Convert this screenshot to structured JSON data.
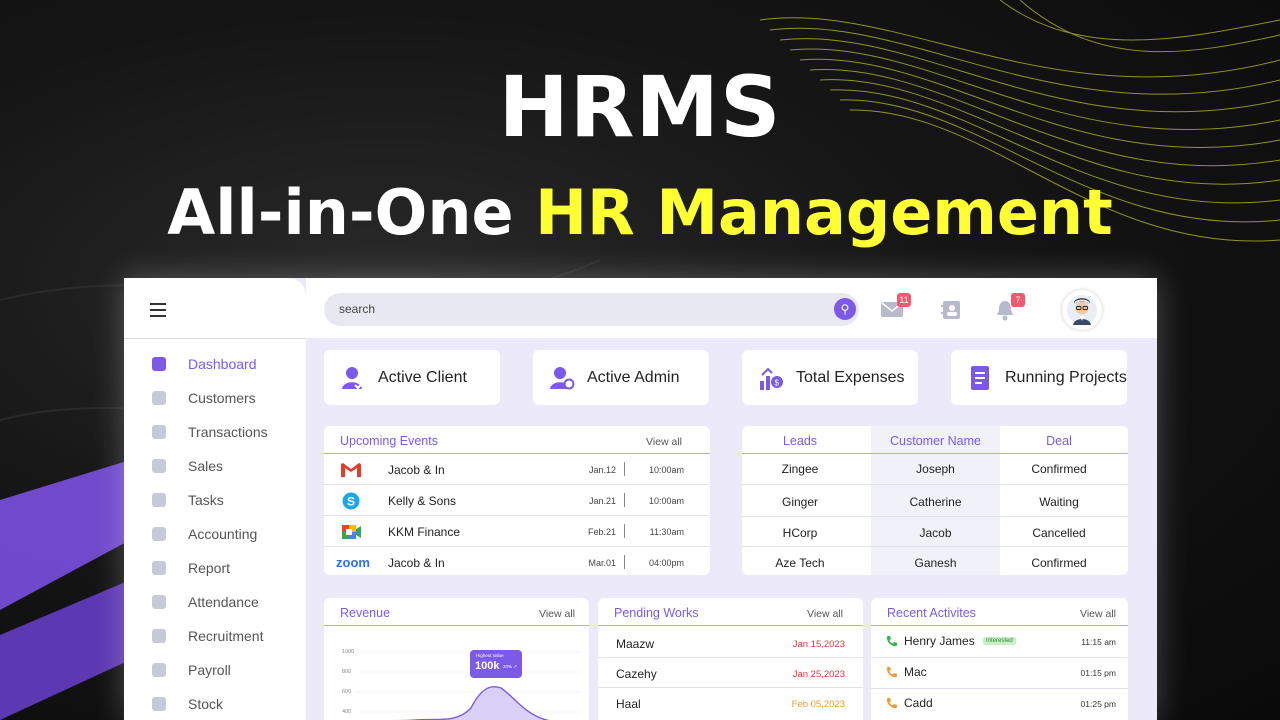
{
  "hero": {
    "title": "HRMS",
    "subtitle_prefix": "All-in-One",
    "subtitle_highlight": "HR Management"
  },
  "topbar": {
    "search_placeholder": "search",
    "mail_badge": "11",
    "notification_badge": "7"
  },
  "sidebar": {
    "items": [
      {
        "label": "Dashboard",
        "icon": "grid-icon",
        "active": true
      },
      {
        "label": "Customers",
        "icon": "star-icon"
      },
      {
        "label": "Transactions",
        "icon": "layers-icon"
      },
      {
        "label": "Sales",
        "icon": "chart-line-icon"
      },
      {
        "label": "Tasks",
        "icon": "task-icon"
      },
      {
        "label": "Accounting",
        "icon": "accounting-icon"
      },
      {
        "label": "Report",
        "icon": "report-icon"
      },
      {
        "label": "Attendance",
        "icon": "attendance-icon"
      },
      {
        "label": "Recruitment",
        "icon": "recruitment-icon"
      },
      {
        "label": "Payroll",
        "icon": "payroll-icon"
      },
      {
        "label": "Stock",
        "icon": "stock-icon"
      }
    ]
  },
  "stats": [
    {
      "label": "Active Client",
      "icon": "client-icon"
    },
    {
      "label": "Active Admin",
      "icon": "admin-icon"
    },
    {
      "label": "Total Expenses",
      "icon": "expenses-icon"
    },
    {
      "label": "Running Projects",
      "icon": "projects-icon"
    }
  ],
  "upcoming_events": {
    "title": "Upcoming Events",
    "view_all": "View all",
    "rows": [
      {
        "logo": "gmail-icon",
        "name": "Jacob & In",
        "date": "Jan.12",
        "time": "10:00am"
      },
      {
        "logo": "skype-icon",
        "name": "Kelly & Sons",
        "date": "Jan.21",
        "time": "10:00am"
      },
      {
        "logo": "meet-icon",
        "name": "KKM Finance",
        "date": "Feb.21",
        "time": "11:30am"
      },
      {
        "logo": "zoom-icon",
        "logo_text": "zoom",
        "name": "Jacob & In",
        "date": "Mar.01",
        "time": "04:00pm"
      }
    ]
  },
  "leads_table": {
    "headers": [
      "Leads",
      "Customer Name",
      "Deal"
    ],
    "rows": [
      [
        "Zingee",
        "Joseph",
        "Confirmed"
      ],
      [
        "Ginger",
        "Catherine",
        "Waiting"
      ],
      [
        "HCorp",
        "Jacob",
        "Cancelled"
      ],
      [
        "Aze Tech",
        "Ganesh",
        "Confirmed"
      ]
    ]
  },
  "revenue": {
    "title": "Revenue",
    "view_all": "View all",
    "y_ticks": [
      "1000",
      "800",
      "600",
      "400"
    ],
    "tooltip_label": "Highest Value",
    "tooltip_value": "100k",
    "tooltip_pct": "20% ↗"
  },
  "pending_works": {
    "title": "Pending Works",
    "view_all": "View all",
    "rows": [
      {
        "name": "Maazw",
        "date": "Jan 15,2023",
        "color": "#e0343b"
      },
      {
        "name": "Cazehy",
        "date": "Jan 25,2023",
        "color": "#e0343b"
      },
      {
        "name": "Haal",
        "date": "Feb 05,2023",
        "color": "#f29a2e"
      }
    ]
  },
  "recent_activities": {
    "title": "Recent Activites",
    "view_all": "View all",
    "rows": [
      {
        "name": "Henry James",
        "tag": "Interested",
        "time": "11:15 am",
        "phone_color": "#2fb84a"
      },
      {
        "name": "Mac",
        "tag": "",
        "time": "01:15 pm",
        "phone_color": "#f29a2e"
      },
      {
        "name": "Cadd",
        "tag": "",
        "time": "01:25 pm",
        "phone_color": "#f29a2e"
      }
    ]
  },
  "colors": {
    "accent": "#7b5ae8",
    "hero_highlight": "#ffff33",
    "badge": "#ef5a6f"
  }
}
